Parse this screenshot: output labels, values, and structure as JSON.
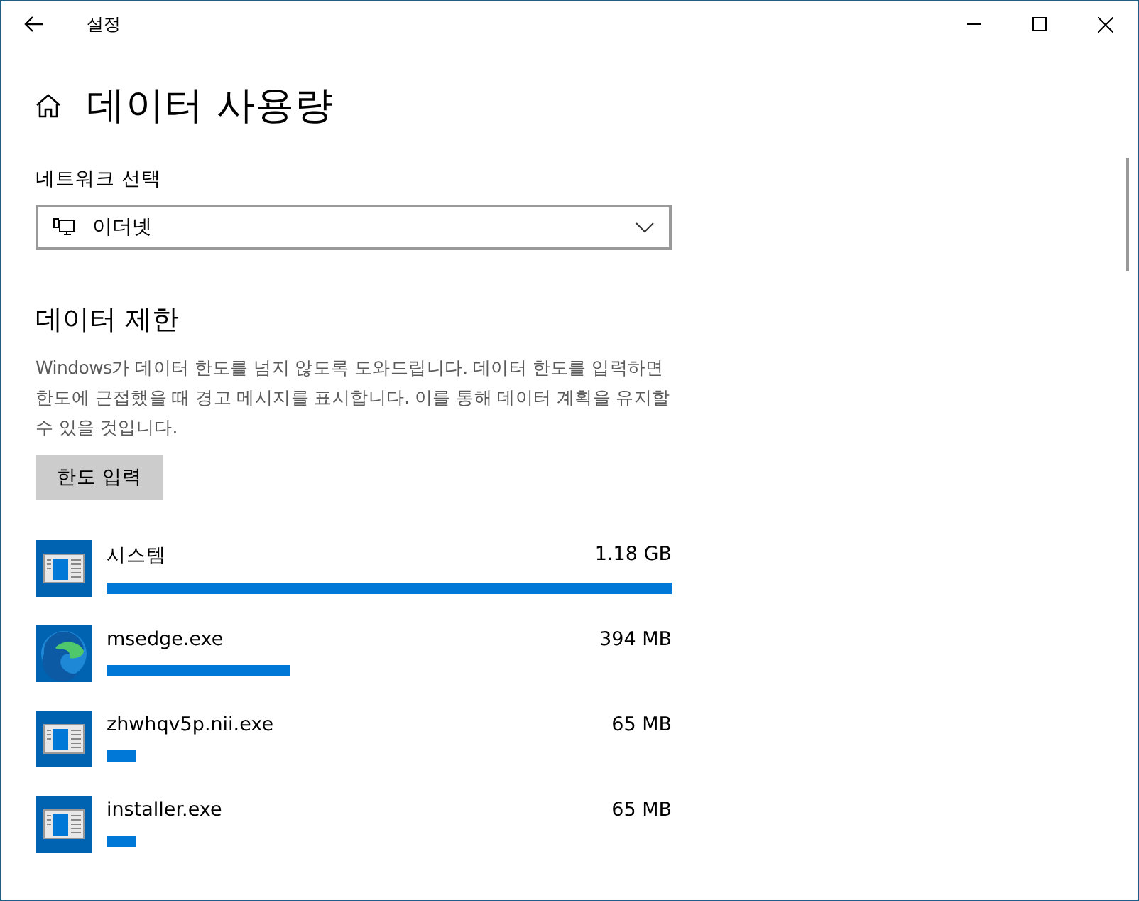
{
  "window": {
    "title": "설정"
  },
  "page": {
    "title": "데이터 사용량"
  },
  "network": {
    "label": "네트워크 선택",
    "value": "이더넷"
  },
  "limit": {
    "heading": "데이터 제한",
    "description": "Windows가 데이터 한도를 넘지 않도록 도와드립니다. 데이터 한도를 입력하면 한도에 근접했을 때 경고 메시지를 표시합니다. 이를 통해 데이터 계획을 유지할 수 있을 것입니다.",
    "button": "한도 입력"
  },
  "apps": [
    {
      "name": "시스템",
      "usage": "1.18 GB",
      "level": 1,
      "kind": "window"
    },
    {
      "name": "msedge.exe",
      "usage": "394 MB",
      "level": 0.325,
      "kind": "edge"
    },
    {
      "name": "zhwhqv5p.nii.exe",
      "usage": "65 MB",
      "level": 0.053,
      "kind": "window"
    },
    {
      "name": "installer.exe",
      "usage": "65 MB",
      "level": 0.053,
      "kind": "window"
    }
  ]
}
